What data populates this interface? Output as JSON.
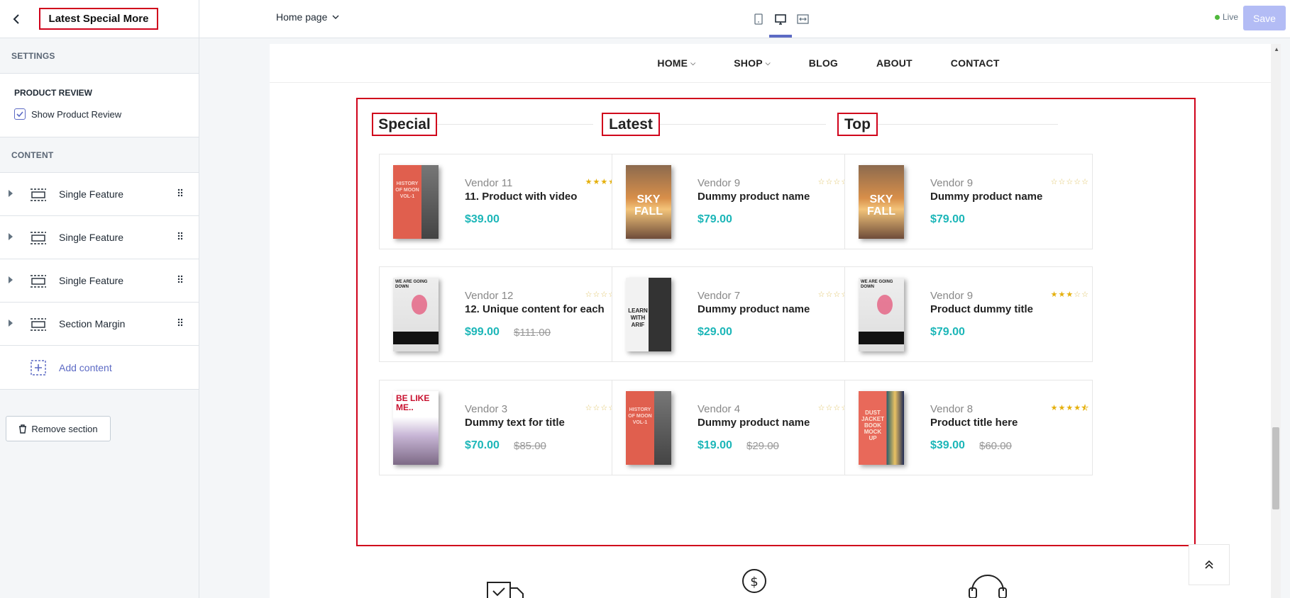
{
  "sidebar": {
    "title": "Latest Special More",
    "settings_label": "SETTINGS",
    "review_heading": "PRODUCT REVIEW",
    "review_checkbox": "Show Product Review",
    "content_label": "CONTENT",
    "items": [
      {
        "label": "Single Feature"
      },
      {
        "label": "Single Feature"
      },
      {
        "label": "Single Feature"
      },
      {
        "label": "Section Margin"
      }
    ],
    "add_content": "Add content",
    "remove_section": "Remove section"
  },
  "topbar": {
    "page_select": "Home page",
    "live": "Live",
    "save": "Save"
  },
  "nav": {
    "items": [
      "HOME",
      "SHOP",
      "BLOG",
      "ABOUT",
      "CONTACT"
    ]
  },
  "columns": [
    {
      "title": "Special"
    },
    {
      "title": "Latest"
    },
    {
      "title": "Top"
    }
  ],
  "products": [
    [
      {
        "vendor": "Vendor 11",
        "name": "11. Product with video",
        "price": "$39.00",
        "old_price": "",
        "rating": 5,
        "cover": "history"
      },
      {
        "vendor": "Vendor 12",
        "name": "12. Unique content for each",
        "price": "$99.00",
        "old_price": "$111.00",
        "rating": 0,
        "cover": "wearegoing"
      },
      {
        "vendor": "Vendor 3",
        "name": "Dummy text for title",
        "price": "$70.00",
        "old_price": "$85.00",
        "rating": 0,
        "cover": "belikeme"
      }
    ],
    [
      {
        "vendor": "Vendor 9",
        "name": "Dummy product name",
        "price": "$79.00",
        "old_price": "",
        "rating": 0,
        "cover": "skyfall"
      },
      {
        "vendor": "Vendor 7",
        "name": "Dummy product name",
        "price": "$29.00",
        "old_price": "",
        "rating": 0,
        "cover": "learn"
      },
      {
        "vendor": "Vendor 4",
        "name": "Dummy product name",
        "price": "$19.00",
        "old_price": "$29.00",
        "rating": 0,
        "cover": "history"
      }
    ],
    [
      {
        "vendor": "Vendor 9",
        "name": "Dummy product name",
        "price": "$79.00",
        "old_price": "",
        "rating": 0,
        "cover": "skyfall"
      },
      {
        "vendor": "Vendor 9",
        "name": "Product dummy title",
        "price": "$79.00",
        "old_price": "",
        "rating": 3,
        "cover": "wearegoing"
      },
      {
        "vendor": "Vendor 8",
        "name": "Product title here",
        "price": "$39.00",
        "old_price": "$60.00",
        "rating": 4.5,
        "cover": "dustjacket"
      }
    ]
  ],
  "cover_text": {
    "history": "HISTORY OF MOON VOL-1",
    "skyfall": "SKY FALL",
    "wearegoing": "WE ARE GOING DOWN",
    "belikeme": "BE LIKE ME..",
    "learn": "LEARN WITH ARIF",
    "dustjacket": "DUST JACKET BOOK MOCK UP"
  },
  "colors": {
    "accent": "#5c6ac4",
    "price": "#1cb6b8",
    "highlight": "#d0021b",
    "star": "#e5b00c"
  }
}
